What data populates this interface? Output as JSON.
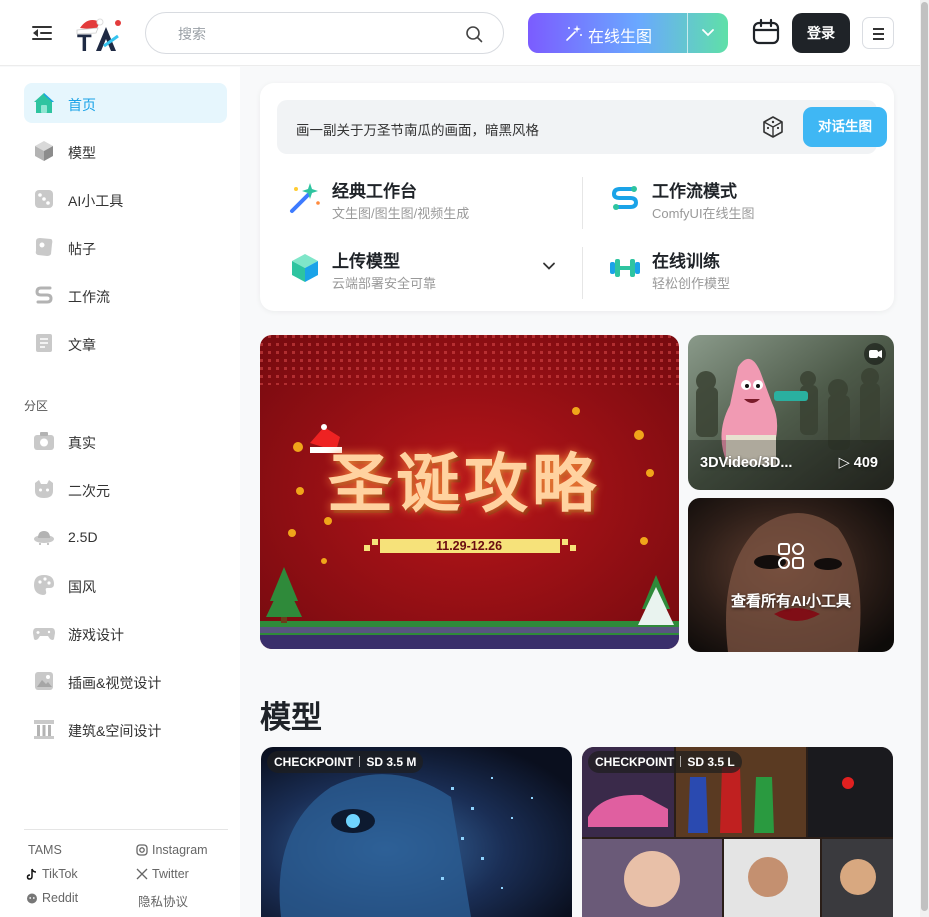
{
  "header": {
    "search_placeholder": "搜索",
    "gen_button_label": "在线生图",
    "login_label": "登录",
    "accent_gradient": [
      "#7b5cff",
      "#6aa8ff",
      "#5fe0a8"
    ]
  },
  "sidebar": {
    "items": [
      {
        "label": "首页",
        "icon": "home-icon",
        "active": true
      },
      {
        "label": "模型",
        "icon": "cube-icon"
      },
      {
        "label": "AI小工具",
        "icon": "dice-icon"
      },
      {
        "label": "帖子",
        "icon": "post-icon"
      },
      {
        "label": "工作流",
        "icon": "workflow-icon"
      },
      {
        "label": "文章",
        "icon": "article-icon"
      }
    ],
    "section_label": "分区",
    "categories": [
      {
        "label": "真实",
        "icon": "camera-icon"
      },
      {
        "label": "二次元",
        "icon": "anime-face-icon"
      },
      {
        "label": "2.5D",
        "icon": "ufo-icon"
      },
      {
        "label": "国风",
        "icon": "palette-icon"
      },
      {
        "label": "游戏设计",
        "icon": "gamepad-icon"
      },
      {
        "label": "插画&视觉设计",
        "icon": "illustration-icon"
      },
      {
        "label": "建筑&空间设计",
        "icon": "column-icon"
      }
    ],
    "footer": {
      "tams": "TAMS",
      "instagram": "Instagram",
      "tiktok": "TikTok",
      "twitter": "Twitter",
      "reddit": "Reddit",
      "privacy": "隐私协议"
    },
    "active_color": "#1aa3e8"
  },
  "quick": {
    "prompt_text": "画一副关于万圣节南瓜的画面，暗黑风格",
    "chat_gen_label": "对话生图",
    "features": [
      {
        "title": "经典工作台",
        "subtitle": "文生图/图生图/视频生成",
        "icon": "magic-wand-icon"
      },
      {
        "title": "工作流模式",
        "subtitle": "ComfyUI在线生图",
        "icon": "workflow-s-icon"
      },
      {
        "title": "上传模型",
        "subtitle": "云端部署安全可靠",
        "icon": "upload-cube-icon"
      },
      {
        "title": "在线训练",
        "subtitle": "轻松创作模型",
        "icon": "dumbbell-icon"
      }
    ]
  },
  "banner": {
    "title": "圣诞攻略",
    "date_range": "11.29-12.26"
  },
  "tiles": {
    "video": {
      "name": "3DVideo/3D...",
      "count": "▷ 409"
    },
    "tools": {
      "label": "查看所有AI小工具"
    }
  },
  "models": {
    "section_title": "模型",
    "cards": [
      {
        "type": "CHECKPOINT",
        "base": "SD 3.5 M"
      },
      {
        "type": "CHECKPOINT",
        "base": "SD 3.5 L"
      }
    ]
  }
}
